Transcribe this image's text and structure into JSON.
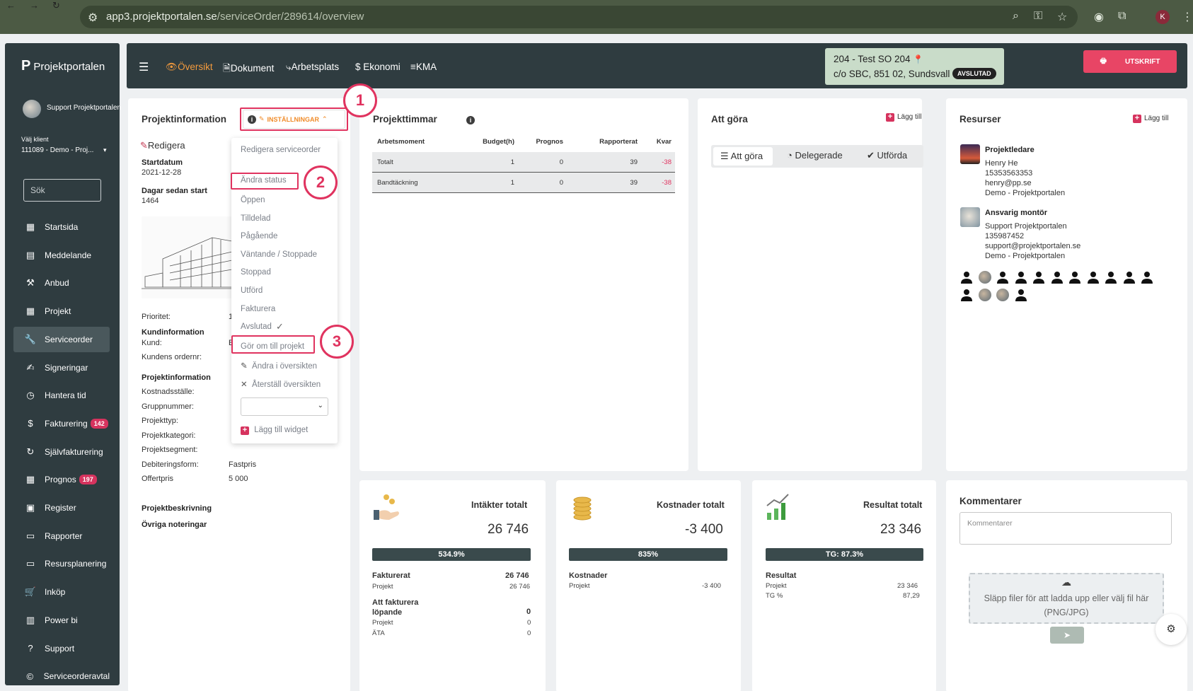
{
  "browser": {
    "url_host": "app3.projektportalen.se",
    "url_path": "/serviceOrder/289614/overview",
    "profile_initial": "K"
  },
  "sidebar": {
    "logo_text": "Projektportalen",
    "user_name": "Support Projektportalen",
    "client_label": "Välj klient",
    "client_value": "111089 - Demo - Proj...",
    "search_placeholder": "Sök",
    "items": [
      {
        "label": "Startsida",
        "icon": "dashboard-icon"
      },
      {
        "label": "Meddelande",
        "icon": "message-icon"
      },
      {
        "label": "Anbud",
        "icon": "gavel-icon"
      },
      {
        "label": "Projekt",
        "icon": "grid-icon"
      },
      {
        "label": "Serviceorder",
        "icon": "wrench-icon",
        "active": true
      },
      {
        "label": "Signeringar",
        "icon": "sign-icon"
      },
      {
        "label": "Hantera tid",
        "icon": "clock-icon"
      },
      {
        "label": "Fakturering",
        "icon": "dollar-icon",
        "badge": "142"
      },
      {
        "label": "Självfakturering",
        "icon": "cycle-icon"
      },
      {
        "label": "Prognos",
        "icon": "grid-icon",
        "badge": "197"
      },
      {
        "label": "Register",
        "icon": "register-icon"
      },
      {
        "label": "Rapporter",
        "icon": "calendar-icon"
      },
      {
        "label": "Resursplanering",
        "icon": "calendar-icon"
      },
      {
        "label": "Inköp",
        "icon": "cart-icon"
      },
      {
        "label": "Power bi",
        "icon": "chart-icon"
      },
      {
        "label": "Support",
        "icon": "help-icon"
      },
      {
        "label": "Serviceorderavtal",
        "icon": "contract-icon"
      }
    ]
  },
  "topnav": {
    "tabs": [
      {
        "label": "Översikt",
        "active": true
      },
      {
        "label": "Dokument"
      },
      {
        "label": "Arbetsplats"
      },
      {
        "label": "Ekonomi"
      },
      {
        "label": "KMA"
      }
    ],
    "order_line1": "204 - Test SO 204",
    "order_line2": "c/o SBC, 851 02, Sundsvall",
    "status_badge": "AVSLUTAD",
    "print_label": "UTSKRIFT"
  },
  "project_info": {
    "title": "Projektinformation",
    "settings_label": "INSTÄLLNINGAR",
    "edit_label": "Redigera",
    "start_label": "Startdatum",
    "start_value": "2021-12-28",
    "days_label": "Dagar sedan start",
    "days_value": "1464",
    "priority_label": "Prioritet:",
    "priority_value": "1",
    "customer_heading": "Kundinformation",
    "customer_label": "Kund:",
    "customer_value": "E",
    "order_no_label": "Kundens ordernr:",
    "pi_heading": "Projektinformation",
    "fields": [
      {
        "label": "Kostnadsställe:",
        "value": ""
      },
      {
        "label": "Gruppnummer:",
        "value": ""
      },
      {
        "label": "Projekttyp:",
        "value": ""
      },
      {
        "label": "Projektkategori:",
        "value": ""
      },
      {
        "label": "Projektsegment:",
        "value": ""
      },
      {
        "label": "Debiteringsform:",
        "value": "Fastpris"
      },
      {
        "label": "Offertpris",
        "value": "5 000"
      }
    ],
    "description_label": "Projektbeskrivning",
    "notes_label": "Övriga noteringar"
  },
  "menu": {
    "edit_order": "Redigera serviceorder",
    "change_status": "Ändra status",
    "statuses": [
      "Öppen",
      "Tilldelad",
      "Pågående",
      "Väntande / Stoppade",
      "Stoppad",
      "Utförd",
      "Fakturera",
      "Avslutad"
    ],
    "convert": "Gör om till projekt",
    "edit_overview": "Ändra i översikten",
    "reset_overview": "Återställ översikten",
    "add_widget": "Lägg till widget"
  },
  "annotations": [
    "1",
    "2",
    "3"
  ],
  "hours": {
    "title": "Projekttimmar",
    "columns": [
      "Arbetsmoment",
      "Budget(h)",
      "Prognos",
      "Rapporterat",
      "Kvar"
    ],
    "rows": [
      [
        "Totalt",
        "1",
        "0",
        "39",
        "-38"
      ],
      [
        "Bandtäckning",
        "1",
        "0",
        "39",
        "-38"
      ]
    ]
  },
  "todo": {
    "title": "Att göra",
    "add_label": "Lägg till",
    "tabs": [
      "Att göra",
      "Delegerade",
      "Utförda"
    ]
  },
  "resources": {
    "title": "Resurser",
    "add_label": "Lägg till",
    "people": [
      {
        "role": "Projektledare",
        "name": "Henry He",
        "phone": "15353563353",
        "email": "henry@pp.se",
        "company": "Demo - Projektportalen"
      },
      {
        "role": "Ansvarig montör",
        "name": "Support Projektportalen",
        "phone": "135987452",
        "email": "support@projektportalen.se",
        "company": "Demo - Projektportalen"
      }
    ]
  },
  "finance": {
    "income": {
      "title": "Intäkter totalt",
      "total": "26 746",
      "bar": "534.9%",
      "l1": "Fakturerat",
      "l1_val": "26 746",
      "l1_sub": "Projekt",
      "l1_sub_val": "26 746",
      "l2": "Att fakturera löpande",
      "l2_val": "0",
      "l2_sub1": "Projekt",
      "l2_sub1_val": "0",
      "l2_sub2": "ÄTA",
      "l2_sub2_val": "0"
    },
    "costs": {
      "title": "Kostnader totalt",
      "total": "-3 400",
      "bar": "835%",
      "l1": "Kostnader",
      "l1_sub": "Projekt",
      "l1_sub_val": "-3 400"
    },
    "result": {
      "title": "Resultat totalt",
      "total": "23 346",
      "bar": "TG: 87.3%",
      "l1": "Resultat",
      "l1_sub": "Projekt",
      "l1_sub_val": "23 346",
      "l1_sub2": "TG %",
      "l1_sub2_val": "87,29"
    }
  },
  "comments": {
    "title": "Kommentarer",
    "placeholder": "Kommentarer",
    "dropzone": "Släpp filer för att ladda upp eller välj fil här (PNG/JPG)"
  },
  "colors": {
    "sidebar": "#2f3c40",
    "accent_orange": "#f39a3d",
    "accent_pink": "#e0335f",
    "order_box": "#c9dcc9"
  }
}
